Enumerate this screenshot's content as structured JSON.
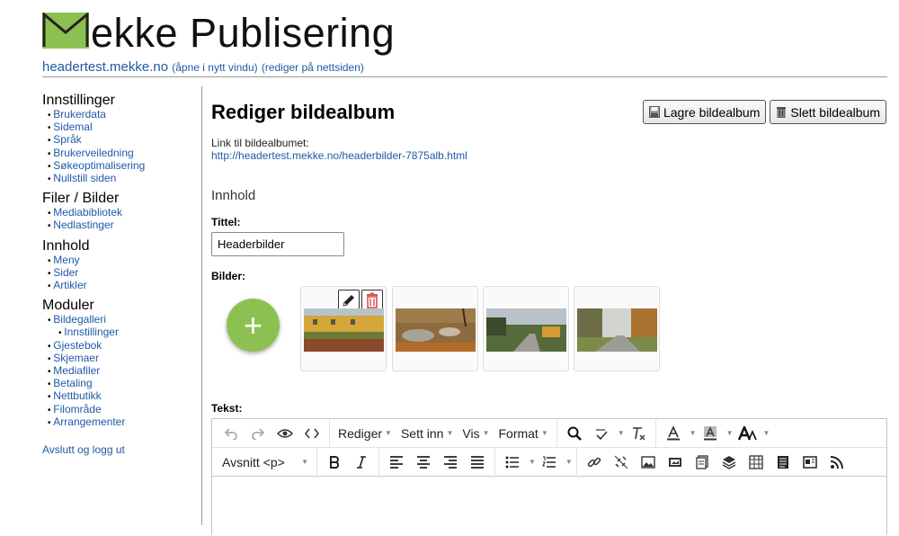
{
  "header": {
    "logo_text": "ekke Publisering",
    "site_domain": "headertest.mekke.no",
    "open_new_window": "(åpne i nytt vindu)",
    "edit_on_site": "(rediger på nettsiden)"
  },
  "sidebar": {
    "sections": [
      {
        "title": "Innstillinger",
        "items": [
          "Brukerdata",
          "Sidemal",
          "Språk",
          "Brukerveiledning",
          "Søkeoptimalisering",
          "Nullstill siden"
        ]
      },
      {
        "title": "Filer / Bilder",
        "items": [
          "Mediabibliotek",
          "Nedlastinger"
        ]
      },
      {
        "title": "Innhold",
        "items": [
          "Meny",
          "Sider",
          "Artikler"
        ]
      },
      {
        "title": "Moduler",
        "items": [
          "Bildegalleri",
          "Innstillinger",
          "Gjestebok",
          "Skjemaer",
          "Mediafiler",
          "Betaling",
          "Nettbutikk",
          "Filområde",
          "Arrangementer"
        ]
      }
    ],
    "logout": "Avslutt og logg ut"
  },
  "main": {
    "title": "Rediger bildealbum",
    "save_button": "Lagre bildealbum",
    "delete_button": "Slett bildealbum",
    "link_label": "Link til bildealbumet:",
    "link_url": "http://headertest.mekke.no/headerbilder-7875alb.html",
    "content_heading": "Innhold",
    "title_label": "Tittel:",
    "title_value": "Headerbilder",
    "images_label": "Bilder:",
    "add_symbol": "+",
    "text_label": "Tekst:"
  },
  "editor": {
    "menus": [
      "Rediger",
      "Sett inn",
      "Vis",
      "Format"
    ],
    "block_format": "Avsnitt <p>"
  },
  "colors": {
    "logo_green": "#8cc152",
    "link_blue": "#1f5aa6",
    "delete_red": "#d9534f"
  }
}
